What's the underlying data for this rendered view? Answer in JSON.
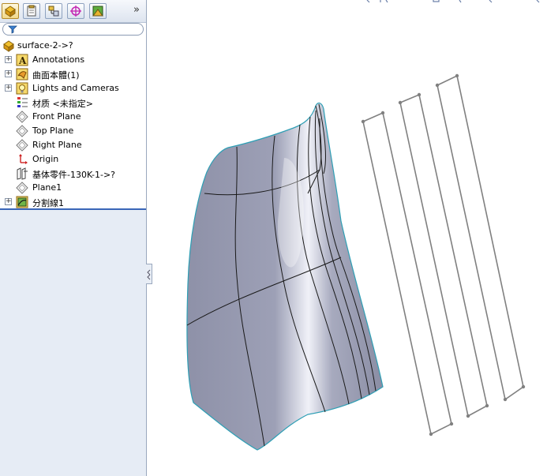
{
  "feature_manager": {
    "toolbar": {
      "tabs": [
        "feature-manager-icon",
        "property-manager-icon",
        "configuration-manager-icon",
        "dimxpert-icon",
        "display-manager-icon"
      ],
      "more_glyph": "»"
    },
    "filter": {
      "placeholder": ""
    },
    "root": {
      "label": "surface-2->?"
    },
    "items": [
      {
        "label": "Annotations",
        "icon": "annotations-icon",
        "expandable": true
      },
      {
        "label": "曲面本體(1)",
        "icon": "surface-bodies-icon",
        "expandable": true
      },
      {
        "label": "Lights and Cameras",
        "icon": "lights-cameras-icon",
        "expandable": true
      },
      {
        "label": "材质 <未指定>",
        "icon": "material-icon",
        "expandable": false
      },
      {
        "label": "Front Plane",
        "icon": "plane-icon",
        "expandable": false
      },
      {
        "label": "Top Plane",
        "icon": "plane-icon",
        "expandable": false
      },
      {
        "label": "Right Plane",
        "icon": "plane-icon",
        "expandable": false
      },
      {
        "label": "Origin",
        "icon": "origin-icon",
        "expandable": false
      },
      {
        "label": "基体零件-130K-1->?",
        "icon": "base-part-icon",
        "expandable": false
      },
      {
        "label": "Plane1",
        "icon": "plane-icon",
        "expandable": false
      },
      {
        "label": "分割線1",
        "icon": "split-line-icon",
        "expandable": true
      }
    ]
  },
  "colors": {
    "surface_fill": "#9a9db4",
    "surface_edge": "#2e9fb5",
    "sketch_line": "#808080",
    "selection_bar": "#3a66b8"
  }
}
